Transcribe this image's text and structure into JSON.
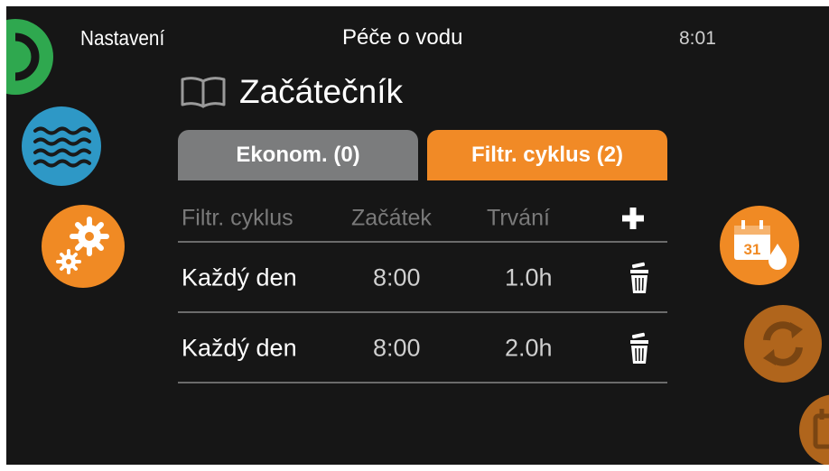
{
  "header": {
    "nav_label": "Nastavení",
    "title": "Péče o vodu",
    "time": "8:01"
  },
  "mode": {
    "icon": "book-icon",
    "title": "Začátečník"
  },
  "tabs": [
    {
      "label": "Ekonom. (0)",
      "color": "#7b7c7d",
      "selected": false
    },
    {
      "label": "Filtr. cyklus (2)",
      "color": "#f18a26",
      "selected": true
    }
  ],
  "table": {
    "headers": [
      "Filtr. cyklus",
      "Začátek",
      "Trvání"
    ],
    "add_icon": "plus-icon",
    "rows": [
      {
        "cycle": "Každý den",
        "start": "8:00",
        "duration": "1.0h",
        "delete_icon": "trash-icon"
      },
      {
        "cycle": "Každý den",
        "start": "8:00",
        "duration": "2.0h",
        "delete_icon": "trash-icon"
      }
    ]
  },
  "left_menu": [
    {
      "icon": "green-partial-icon",
      "color": "#2fa84f"
    },
    {
      "icon": "water-waves-icon",
      "color": "#2e98c6"
    },
    {
      "icon": "gears-icon",
      "color": "#f08a24"
    }
  ],
  "right_menu": [
    {
      "icon": "calendar-water-icon",
      "color": "#f08a24",
      "day": "31"
    },
    {
      "icon": "refresh-cycle-icon",
      "color": "#b0651c"
    },
    {
      "icon": "calendar-partial-icon",
      "color": "#b0651c"
    }
  ]
}
